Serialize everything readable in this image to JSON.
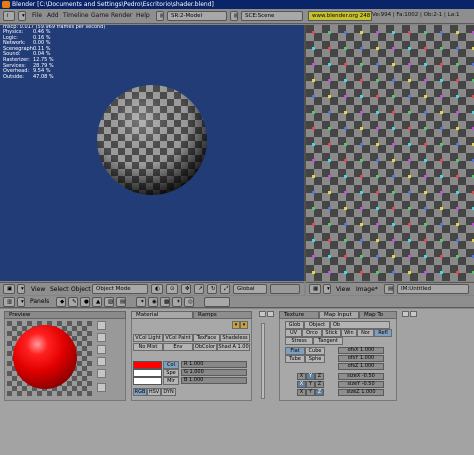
{
  "window": {
    "title": "Blender [C:\\Documents and Settings\\Pedro\\Escritorio\\shader.blend]"
  },
  "top_menu": [
    "File",
    "Add",
    "Timeline",
    "Game",
    "Render",
    "Help"
  ],
  "screen_select": "SR:2-Model",
  "scene_select": "SCE:Scene",
  "url": "www.blender.org 248",
  "scene_stats": "Ve:994 | Fa:1002 | Ob:2-1 | La:1",
  "viewport": {
    "fps_line": "mscp: 0.017 (59.969 frames per second)",
    "stats": [
      {
        "label": "Physics:",
        "value": "0.46 %"
      },
      {
        "label": "Logic:",
        "value": "0.16 %"
      },
      {
        "label": "Network:",
        "value": "0.00 %"
      },
      {
        "label": "Scenegraph:",
        "value": "0.11 %"
      },
      {
        "label": "Sound:",
        "value": "0.04 %"
      },
      {
        "label": "Rasterizer:",
        "value": "12.75 %"
      },
      {
        "label": "Services:",
        "value": "28.79 %"
      },
      {
        "label": "Overhead:",
        "value": "9.54 %"
      },
      {
        "label": "Outside:",
        "value": "47.08 %"
      }
    ]
  },
  "view3d_header": {
    "menus": [
      "View",
      "Select",
      "Object"
    ],
    "mode": "Object Mode",
    "pivot": "Global"
  },
  "image_header": {
    "menus": [
      "View",
      "Image*"
    ],
    "image_name": "IM:Untitled"
  },
  "buttons_header": {
    "panels_label": "Panels"
  },
  "preview_panel": {
    "tab": "Preview"
  },
  "material_panel": {
    "tabs": [
      "Material",
      "Ramps"
    ],
    "row1": [
      "VCol Light",
      "VCol Paint",
      "TexFace",
      "Shadeless"
    ],
    "row2": [
      "No Mist",
      "Env",
      "ObColor",
      "Shad A 1.00"
    ],
    "color_labels": [
      "Col",
      "Spe",
      "Mir"
    ],
    "sliders": [
      "R 1.000",
      "G 1.000",
      "B 1.000"
    ],
    "modes": [
      "RGB",
      "HSV",
      "DYN"
    ]
  },
  "texture_panel": {
    "tabs": [
      "Texture",
      "Map Input",
      "Map To"
    ],
    "row1": [
      "Glob",
      "Object",
      "Ob"
    ],
    "row2": [
      "UV",
      "Orco",
      "Stick",
      "Win",
      "Nor",
      "Refl"
    ],
    "row3": [
      "Stress",
      "Tangent"
    ],
    "proj_left": [
      "Flat",
      "Tube"
    ],
    "proj_right": [
      "Cube",
      "Sphe"
    ],
    "offsets": [
      "ofsX 1.000",
      "ofsY 1.000",
      "ofsZ 1.000"
    ],
    "sizes": [
      "sizeX -0.50",
      "sizeY -0.50",
      "sizeZ 1.000"
    ],
    "axes": [
      "X",
      "Y",
      "Z"
    ]
  }
}
